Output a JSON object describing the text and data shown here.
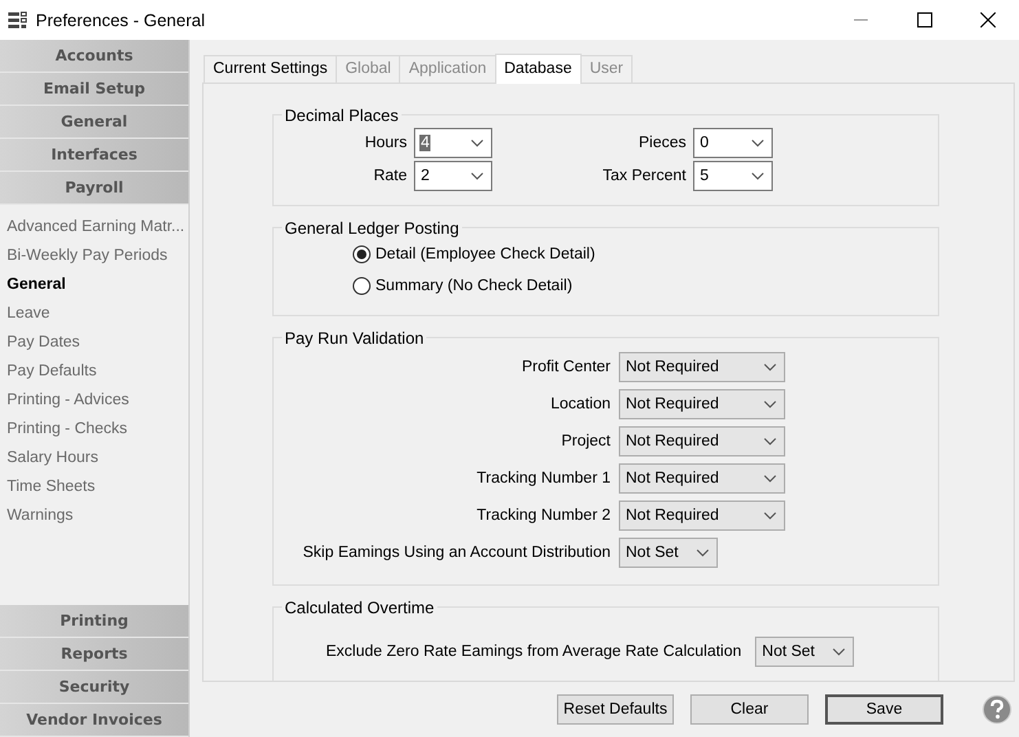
{
  "window": {
    "title": "Preferences - General"
  },
  "sidebar": {
    "top_sections": [
      {
        "label": "Accounts"
      },
      {
        "label": "Email Setup"
      },
      {
        "label": "General"
      },
      {
        "label": "Interfaces"
      },
      {
        "label": "Payroll"
      }
    ],
    "items": [
      {
        "label": "Advanced Earning Matr...",
        "selected": false
      },
      {
        "label": "Bi-Weekly Pay Periods",
        "selected": false
      },
      {
        "label": "General",
        "selected": true
      },
      {
        "label": "Leave",
        "selected": false
      },
      {
        "label": "Pay Dates",
        "selected": false
      },
      {
        "label": "Pay Defaults",
        "selected": false
      },
      {
        "label": "Printing - Advices",
        "selected": false
      },
      {
        "label": "Printing - Checks",
        "selected": false
      },
      {
        "label": "Salary Hours",
        "selected": false
      },
      {
        "label": "Time Sheets",
        "selected": false
      },
      {
        "label": "Warnings",
        "selected": false
      }
    ],
    "bottom_sections": [
      {
        "label": "Printing"
      },
      {
        "label": "Reports"
      },
      {
        "label": "Security"
      },
      {
        "label": "Vendor Invoices"
      }
    ]
  },
  "tabs": [
    {
      "label": "Current Settings",
      "selected": false,
      "disabled": false
    },
    {
      "label": "Global",
      "selected": false,
      "disabled": true
    },
    {
      "label": "Application",
      "selected": false,
      "disabled": true
    },
    {
      "label": "Database",
      "selected": true,
      "disabled": false
    },
    {
      "label": "User",
      "selected": false,
      "disabled": true
    }
  ],
  "decimal_places": {
    "title": "Decimal Places",
    "fields": [
      {
        "label": "Hours",
        "value": "4",
        "focused": true
      },
      {
        "label": "Pieces",
        "value": "0",
        "focused": false
      },
      {
        "label": "Rate",
        "value": "2",
        "focused": false
      },
      {
        "label": "Tax Percent",
        "value": "5",
        "focused": false
      }
    ]
  },
  "general_ledger_posting": {
    "title": "General Ledger Posting",
    "options": [
      {
        "label": "Detail (Employee Check Detail)",
        "selected": true
      },
      {
        "label": "Summary (No Check Detail)",
        "selected": false
      }
    ]
  },
  "pay_run_validation": {
    "title": "Pay Run Validation",
    "fields": [
      {
        "label": "Profit Center",
        "value": "Not Required",
        "kind": "wide"
      },
      {
        "label": "Location",
        "value": "Not Required",
        "kind": "wide"
      },
      {
        "label": "Project",
        "value": "Not Required",
        "kind": "wide"
      },
      {
        "label": "Tracking Number 1",
        "value": "Not Required",
        "kind": "wide"
      },
      {
        "label": "Tracking Number 2",
        "value": "Not Required",
        "kind": "wide"
      },
      {
        "label": "Skip Eamings Using an Account Distribution",
        "value": "Not Set",
        "kind": "narrow"
      }
    ]
  },
  "calculated_overtime": {
    "title": "Calculated Overtime",
    "fields": [
      {
        "label": "Exclude Zero Rate Eamings from Average Rate Calculation",
        "value": "Not Set"
      }
    ]
  },
  "buttons": [
    {
      "label": "Reset Defaults",
      "default": false
    },
    {
      "label": "Clear",
      "default": false
    },
    {
      "label": "Save",
      "default": true
    }
  ]
}
